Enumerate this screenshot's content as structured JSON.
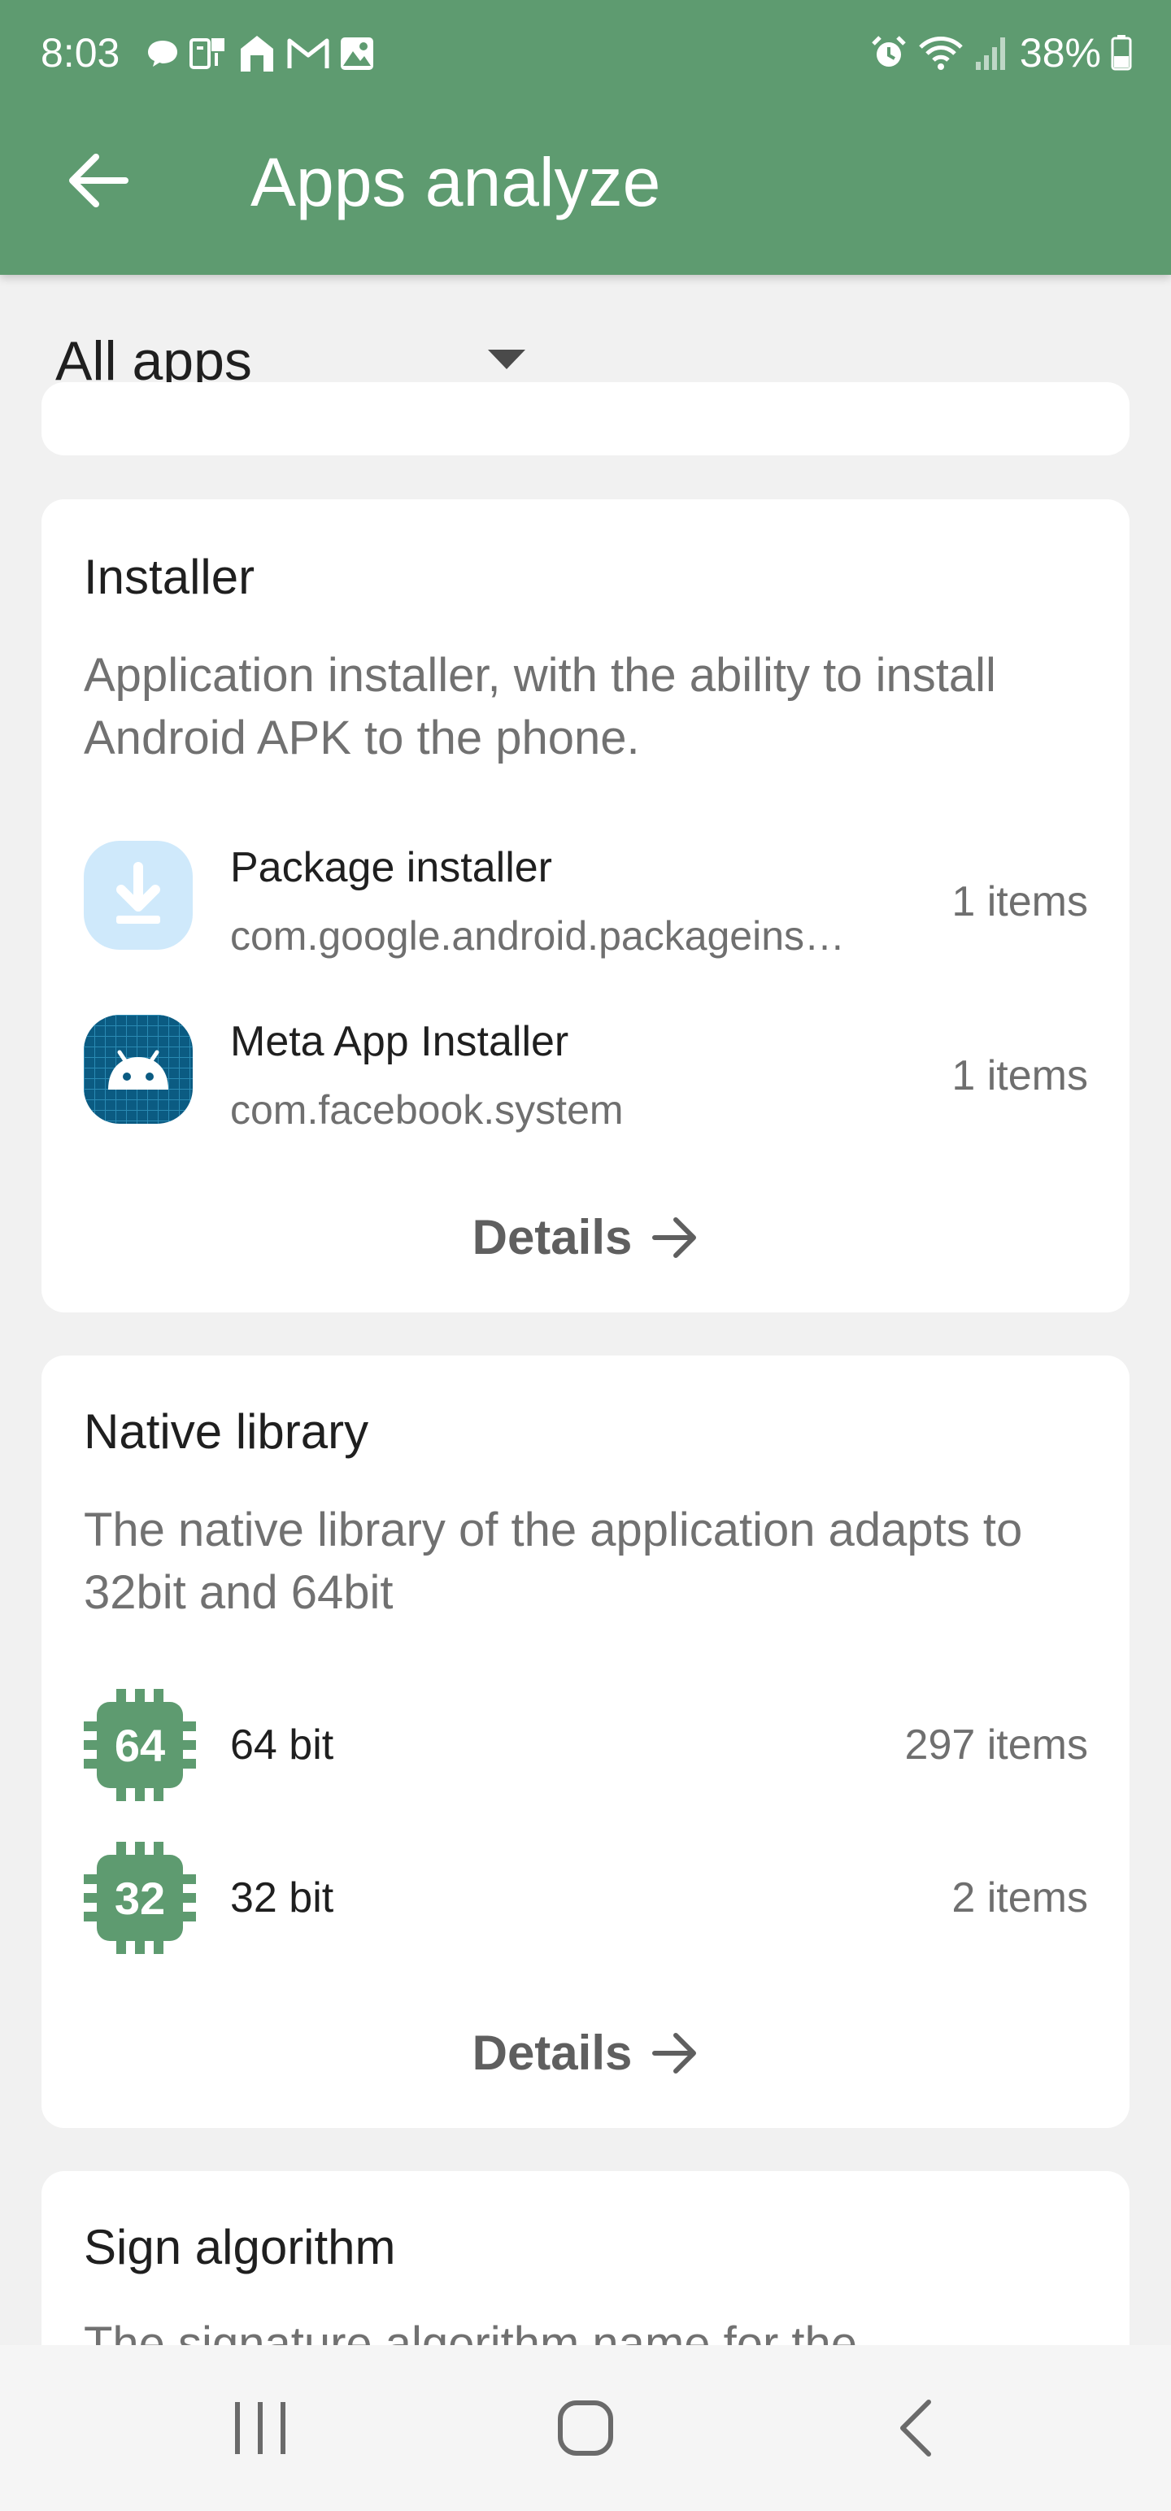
{
  "status_bar": {
    "time": "8:03",
    "battery": "38%",
    "left_icons": [
      "chat-icon",
      "notification-icon",
      "home-app-icon",
      "gmail-icon",
      "gallery-icon"
    ],
    "right_icons": [
      "alarm-icon",
      "wifi-icon",
      "signal-icon",
      "battery-icon"
    ]
  },
  "app_bar": {
    "title": "Apps analyze",
    "background_color": "#5e9b70"
  },
  "filter": {
    "selected": "All apps"
  },
  "cards": {
    "installer": {
      "title": "Installer",
      "description": "Application installer, with the ability to install Android APK to the phone.",
      "rows": [
        {
          "name": "Package installer",
          "package": "com.google.android.packageinstaller",
          "count": "1 items",
          "icon": "download-icon"
        },
        {
          "name": "Meta App Installer",
          "package": "com.facebook.system",
          "count": "1 items",
          "icon": "android-icon"
        }
      ],
      "details_label": "Details"
    },
    "native_library": {
      "title": "Native library",
      "description": "The native library of the application adapts to 32bit and 64bit",
      "rows": [
        {
          "badge": "64",
          "name": "64 bit",
          "count": "297 items"
        },
        {
          "badge": "32",
          "name": "32 bit",
          "count": "2 items"
        }
      ],
      "details_label": "Details"
    },
    "sign_algorithm": {
      "title": "Sign algorithm",
      "description": "The signature algorithm name for the"
    }
  },
  "colors": {
    "accent": "#5e9b70",
    "card": "#ffffff",
    "background": "#f1f1f1"
  }
}
